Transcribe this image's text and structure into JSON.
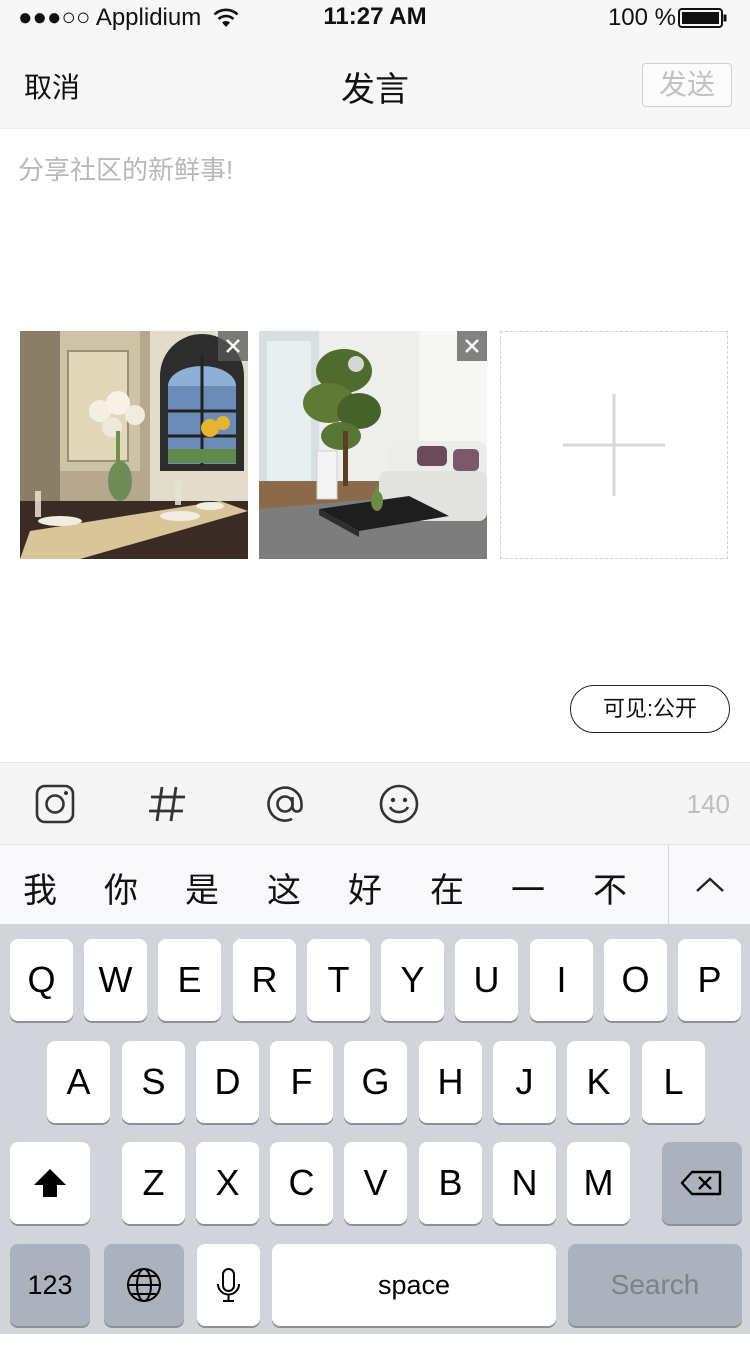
{
  "status_bar": {
    "carrier": "●●●○○ Applidium",
    "time": "11:27 AM",
    "battery": "100 %"
  },
  "nav": {
    "cancel": "取消",
    "title": "发言",
    "send": "发送"
  },
  "compose": {
    "placeholder": "分享社区的新鲜事!",
    "value": ""
  },
  "photos": [
    {
      "icon": "close-icon"
    },
    {
      "icon": "close-icon"
    }
  ],
  "visibility": "可见:公开",
  "toolbar": {
    "icons": [
      "instagram-icon",
      "hashtag-icon",
      "at-icon",
      "smiley-icon"
    ],
    "char_count": "140"
  },
  "candidates": [
    "我",
    "你",
    "是",
    "这",
    "好",
    "在",
    "一",
    "不"
  ],
  "keyboard": {
    "row1": [
      "Q",
      "W",
      "E",
      "R",
      "T",
      "Y",
      "U",
      "I",
      "O",
      "P"
    ],
    "row2": [
      "A",
      "S",
      "D",
      "F",
      "G",
      "H",
      "J",
      "K",
      "L"
    ],
    "row3": [
      "Z",
      "X",
      "C",
      "V",
      "B",
      "N",
      "M"
    ],
    "numbers": "123",
    "space": "space",
    "search": "Search"
  },
  "colors": {
    "bar_bg": "#f7f7f7",
    "keyboard_bg": "#d1d4d9",
    "dark_key": "#acb2bd",
    "placeholder": "#b8b8b8"
  }
}
